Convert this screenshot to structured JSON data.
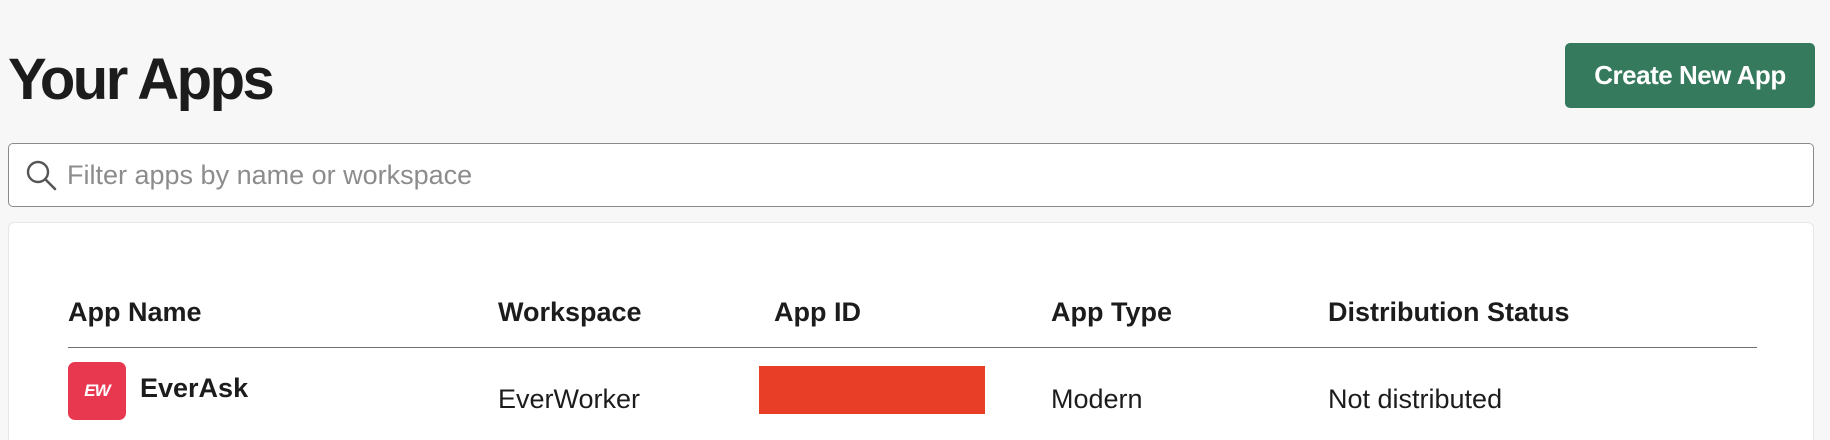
{
  "header": {
    "title": "Your Apps",
    "create_button_label": "Create New App"
  },
  "search": {
    "placeholder": "Filter apps by name or workspace",
    "value": "",
    "icon": "search-icon"
  },
  "table": {
    "columns": [
      "App Name",
      "Workspace",
      "App ID",
      "App Type",
      "Distribution Status"
    ],
    "rows": [
      {
        "app_icon_text": "EW",
        "app_icon_color": "#e8384f",
        "app_name": "EverAsk",
        "workspace": "EverWorker",
        "app_id": "",
        "app_id_redacted": true,
        "app_type": "Modern",
        "distribution_status": "Not distributed"
      }
    ]
  },
  "colors": {
    "background": "#f7f7f7",
    "primary_button": "#357a5d",
    "redaction": "#e83e28",
    "text": "#1d1c1d"
  }
}
